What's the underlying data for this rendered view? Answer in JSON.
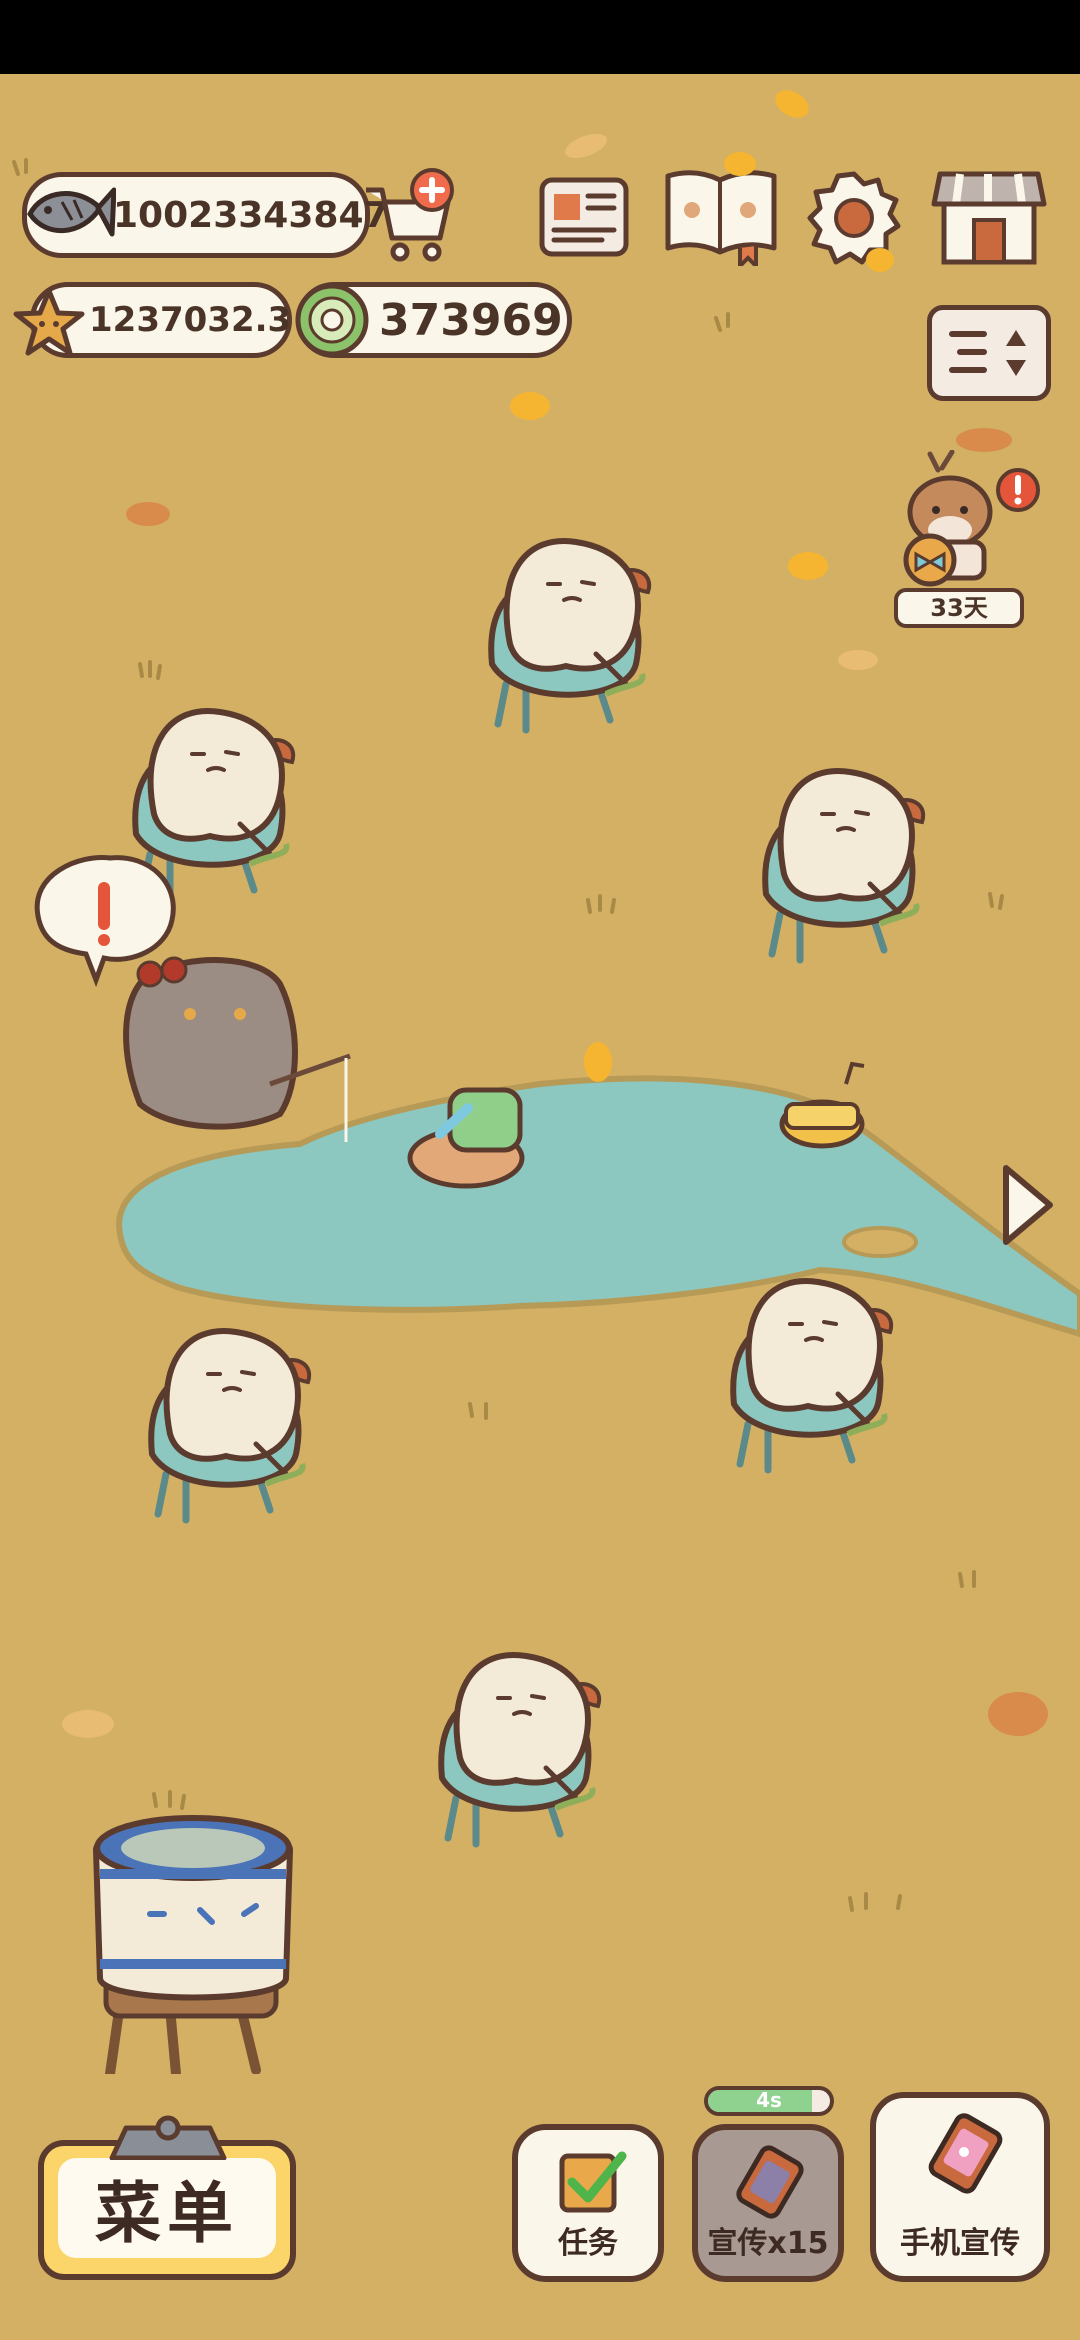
{
  "currency": {
    "fish_value": "10023343847",
    "star_value": "1237032.3",
    "coin_value": "373969"
  },
  "deer_event": {
    "days_label": "33天"
  },
  "bottom": {
    "menu_label": "菜单",
    "task_label": "任务",
    "promo_label": "宣传x15",
    "phone_promo_label": "手机宣传",
    "timer_label": "4s",
    "timer_progress": 0.85
  },
  "icons": {
    "fish": "fish-icon",
    "cart": "shopping-cart-plus-icon",
    "newspaper": "newspaper-icon",
    "book": "paw-book-icon",
    "settings": "gear-icon",
    "shop": "shop-icon",
    "sort": "sort-toggle-icon",
    "star": "star-icon",
    "coin": "green-coin-icon"
  },
  "colors": {
    "background": "#d4b065",
    "outline": "#5b3b2e",
    "pond": "#8cc7c0",
    "menu_yellow": "#fbd56a"
  }
}
